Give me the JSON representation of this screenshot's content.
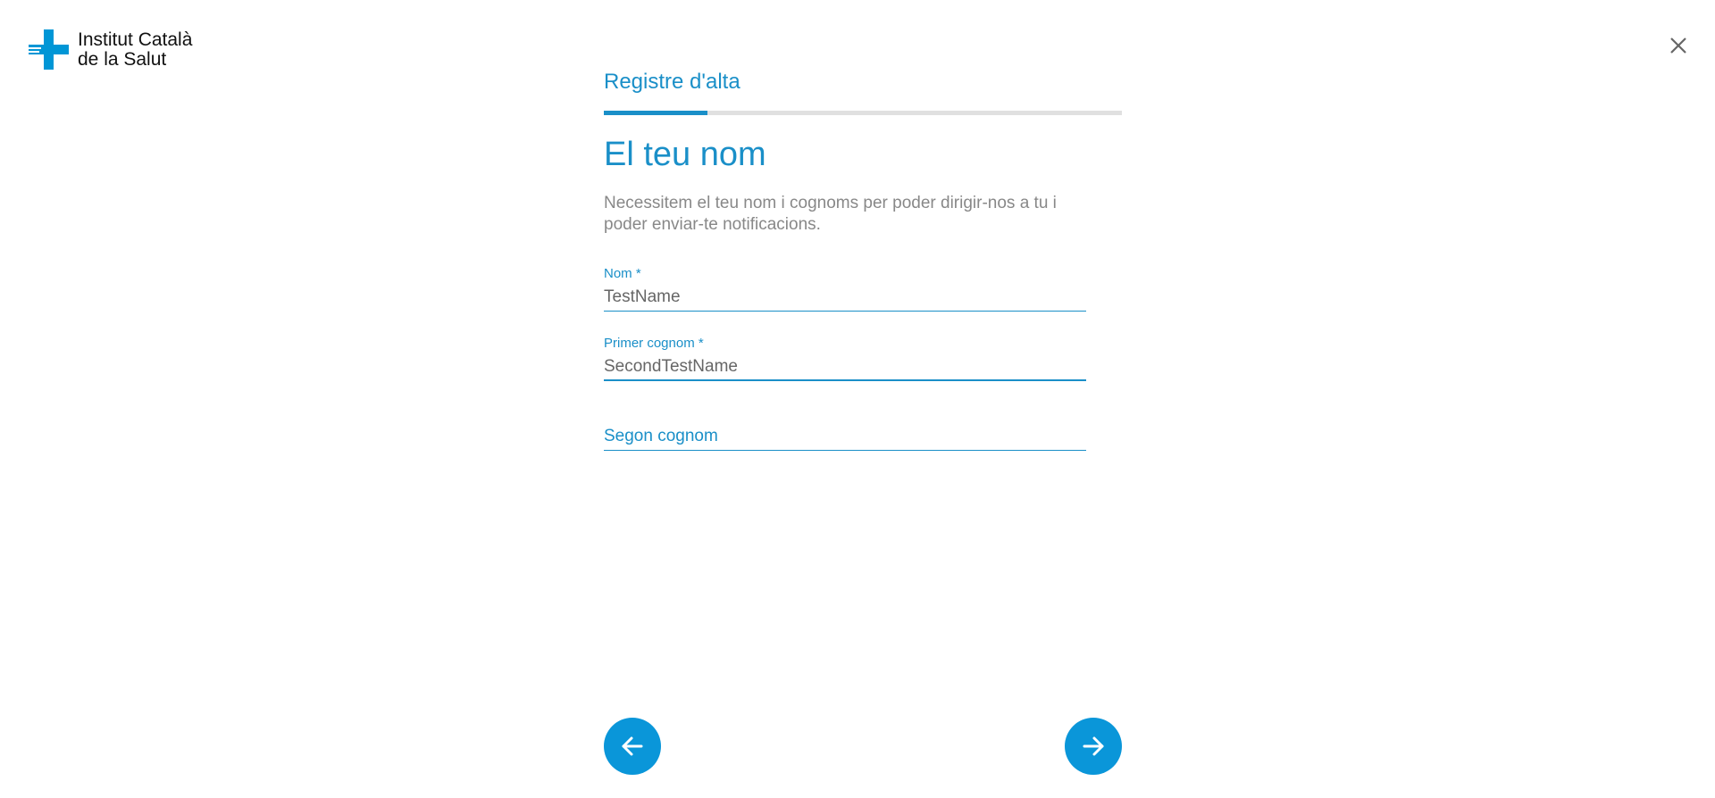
{
  "logo": {
    "line1": "Institut Català",
    "line2": "de la Salut",
    "icon": "health-cross-icon",
    "color": "#0096d6"
  },
  "header": {
    "close_icon": "close-icon"
  },
  "flow": {
    "title": "Registre d'alta",
    "progress_fraction": 0.2
  },
  "step": {
    "title": "El teu nom",
    "description": "Necessitem el teu nom i cognoms per poder dirigir-nos a tu i poder enviar-te notificacions."
  },
  "form": {
    "fields": [
      {
        "label": "Nom *",
        "value": "TestName",
        "placeholder": ""
      },
      {
        "label": "Primer cognom *",
        "value": "SecondTestName",
        "placeholder": ""
      },
      {
        "label": "",
        "value": "",
        "placeholder": "Segon cognom"
      }
    ]
  },
  "navigation": {
    "back_icon": "arrow-left-icon",
    "next_icon": "arrow-right-icon"
  },
  "colors": {
    "accent": "#1a8fc8",
    "button": "#0a96d9",
    "track": "#e0e0e0",
    "muted_text": "#888888"
  }
}
